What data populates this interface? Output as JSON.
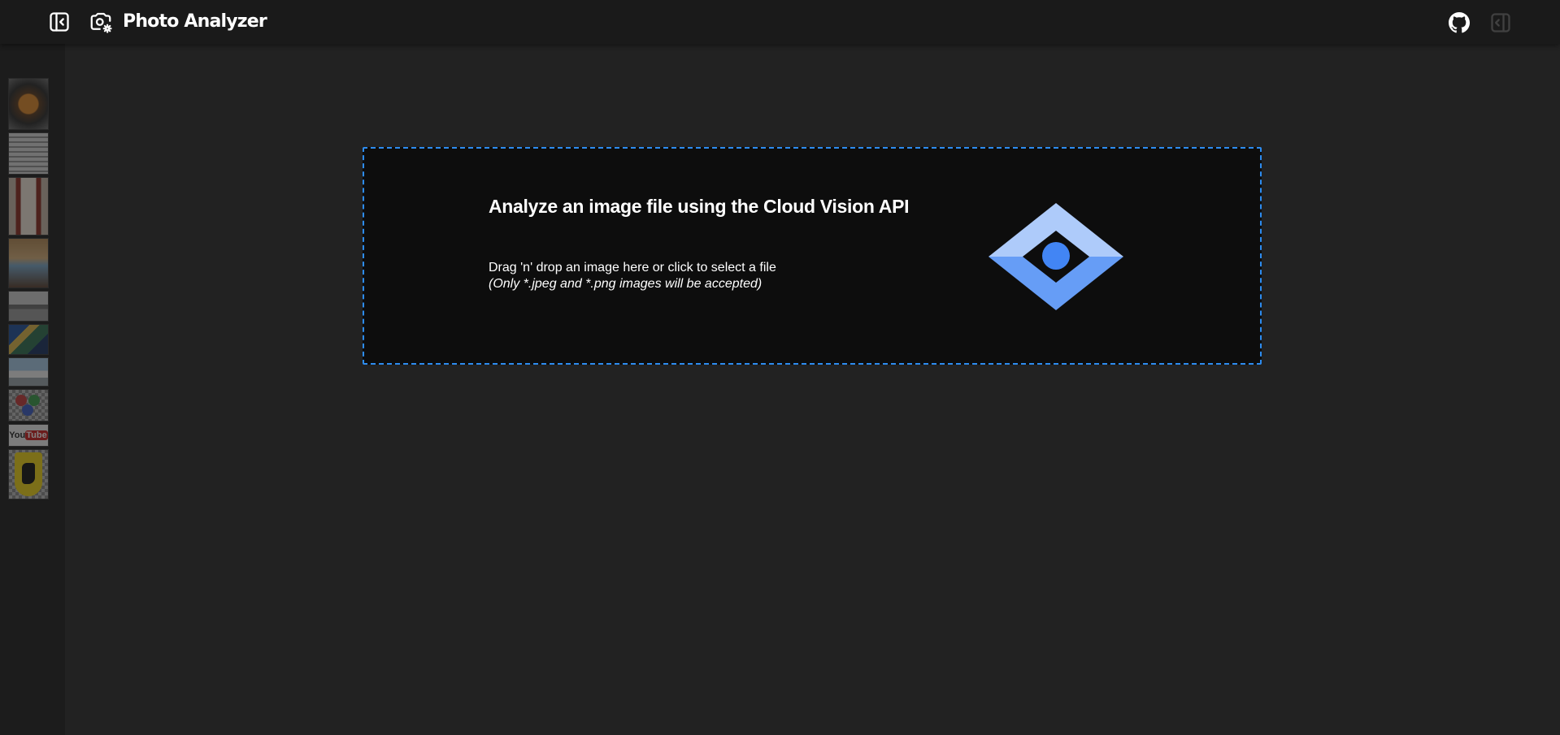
{
  "app": {
    "title": "Photo Analyzer",
    "accent_color": "#2d8cf0"
  },
  "header": {
    "sidebar_toggle_icon": "sidebar-collapse-icon",
    "logo_icon": "camera-settings-icon",
    "github_icon": "github-icon",
    "right_toggle_icon": "panel-toggle-icon"
  },
  "sidebar": {
    "thumbnails": [
      {
        "name": "food-bowl-thumbnail"
      },
      {
        "name": "document-thumbnail"
      },
      {
        "name": "building-facade-thumbnail"
      },
      {
        "name": "interior-thumbnail"
      },
      {
        "name": "landscape-thumbnail"
      },
      {
        "name": "painting-thumbnail"
      },
      {
        "name": "city-thumbnail"
      },
      {
        "name": "emoji-thumbnail"
      },
      {
        "name": "youtube-logo-thumbnail",
        "label": "YouTube"
      },
      {
        "name": "ferrari-logo-thumbnail"
      }
    ]
  },
  "dropzone": {
    "heading": "Analyze an image file using the Cloud Vision API",
    "instructions": "Drag 'n' drop an image here or click to select a file",
    "note": "(Only *.jpeg and *.png images will be accepted)",
    "logo_icon": "cloud-vision-logo-icon",
    "logo_colors": {
      "light": "#aecbfa",
      "mid": "#669df6",
      "dark": "#4285f4"
    }
  }
}
